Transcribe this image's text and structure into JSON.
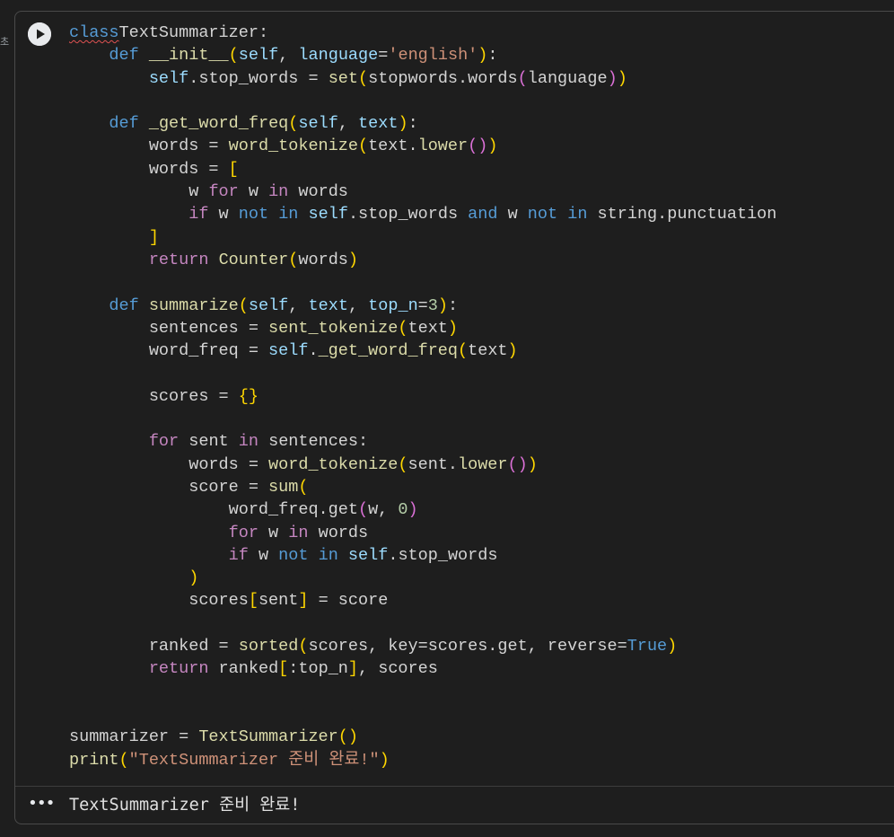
{
  "gutter": {
    "label": "초"
  },
  "cell": {
    "run_label": "run-cell",
    "code_lines": [
      [
        [
          "kw",
          "class",
          true
        ],
        [
          "",
          "TextSummarizer:"
        ]
      ],
      [
        [
          "",
          "    "
        ],
        [
          "kw",
          "def"
        ],
        [
          "",
          " "
        ],
        [
          "fn",
          "__init__"
        ],
        [
          "p1",
          "("
        ],
        [
          "prm",
          "self"
        ],
        [
          "",
          ", "
        ],
        [
          "prm",
          "language"
        ],
        [
          "",
          "="
        ],
        [
          "str",
          "'english'"
        ],
        [
          "p1",
          ")"
        ],
        [
          "",
          ":"
        ]
      ],
      [
        [
          "",
          "        "
        ],
        [
          "prm",
          "self"
        ],
        [
          "",
          ".stop_words = "
        ],
        [
          "fn",
          "set"
        ],
        [
          "p1",
          "("
        ],
        [
          "",
          "stopwords.words"
        ],
        [
          "p2",
          "("
        ],
        [
          "",
          "language"
        ],
        [
          "p2",
          ")"
        ],
        [
          "p1",
          ")"
        ]
      ],
      [
        [
          "",
          ""
        ]
      ],
      [
        [
          "",
          "    "
        ],
        [
          "kw",
          "def"
        ],
        [
          "",
          " "
        ],
        [
          "fn",
          "_get_word_freq"
        ],
        [
          "p1",
          "("
        ],
        [
          "prm",
          "self"
        ],
        [
          "",
          ", "
        ],
        [
          "prm",
          "text"
        ],
        [
          "p1",
          ")"
        ],
        [
          "",
          ":"
        ]
      ],
      [
        [
          "",
          "        words = "
        ],
        [
          "fn",
          "word_tokenize"
        ],
        [
          "p1",
          "("
        ],
        [
          "",
          "text."
        ],
        [
          "fn",
          "lower"
        ],
        [
          "p2",
          "()"
        ],
        [
          "p1",
          ")"
        ]
      ],
      [
        [
          "",
          "        words = "
        ],
        [
          "p1",
          "["
        ]
      ],
      [
        [
          "",
          "            w "
        ],
        [
          "ctl",
          "for"
        ],
        [
          "",
          " w "
        ],
        [
          "ctl",
          "in"
        ],
        [
          "",
          " words"
        ]
      ],
      [
        [
          "",
          "            "
        ],
        [
          "ctl",
          "if"
        ],
        [
          "",
          " w "
        ],
        [
          "kw",
          "not"
        ],
        [
          "",
          " "
        ],
        [
          "kw",
          "in"
        ],
        [
          "",
          " "
        ],
        [
          "prm",
          "self"
        ],
        [
          "",
          ".stop_words "
        ],
        [
          "kw",
          "and"
        ],
        [
          "",
          " w "
        ],
        [
          "kw",
          "not"
        ],
        [
          "",
          " "
        ],
        [
          "kw",
          "in"
        ],
        [
          "",
          " string.punctuation"
        ]
      ],
      [
        [
          "",
          "        "
        ],
        [
          "p1",
          "]"
        ]
      ],
      [
        [
          "",
          "        "
        ],
        [
          "ctl",
          "return"
        ],
        [
          "",
          " "
        ],
        [
          "fn",
          "Counter"
        ],
        [
          "p1",
          "("
        ],
        [
          "",
          "words"
        ],
        [
          "p1",
          ")"
        ]
      ],
      [
        [
          "",
          ""
        ]
      ],
      [
        [
          "",
          "    "
        ],
        [
          "kw",
          "def"
        ],
        [
          "",
          " "
        ],
        [
          "fn",
          "summarize"
        ],
        [
          "p1",
          "("
        ],
        [
          "prm",
          "self"
        ],
        [
          "",
          ", "
        ],
        [
          "prm",
          "text"
        ],
        [
          "",
          ", "
        ],
        [
          "prm",
          "top_n"
        ],
        [
          "",
          "="
        ],
        [
          "num",
          "3"
        ],
        [
          "p1",
          ")"
        ],
        [
          "",
          ":"
        ]
      ],
      [
        [
          "",
          "        sentences = "
        ],
        [
          "fn",
          "sent_tokenize"
        ],
        [
          "p1",
          "("
        ],
        [
          "",
          "text"
        ],
        [
          "p1",
          ")"
        ]
      ],
      [
        [
          "",
          "        word_freq = "
        ],
        [
          "prm",
          "self"
        ],
        [
          "",
          "."
        ],
        [
          "fn",
          "_get_word_freq"
        ],
        [
          "p1",
          "("
        ],
        [
          "",
          "text"
        ],
        [
          "p1",
          ")"
        ]
      ],
      [
        [
          "",
          ""
        ]
      ],
      [
        [
          "",
          "        scores = "
        ],
        [
          "p1",
          "{}"
        ]
      ],
      [
        [
          "",
          ""
        ]
      ],
      [
        [
          "",
          "        "
        ],
        [
          "ctl",
          "for"
        ],
        [
          "",
          " sent "
        ],
        [
          "ctl",
          "in"
        ],
        [
          "",
          " sentences:"
        ]
      ],
      [
        [
          "",
          "            words = "
        ],
        [
          "fn",
          "word_tokenize"
        ],
        [
          "p1",
          "("
        ],
        [
          "",
          "sent."
        ],
        [
          "fn",
          "lower"
        ],
        [
          "p2",
          "()"
        ],
        [
          "p1",
          ")"
        ]
      ],
      [
        [
          "",
          "            score = "
        ],
        [
          "fn",
          "sum"
        ],
        [
          "p1",
          "("
        ]
      ],
      [
        [
          "",
          "                word_freq.get"
        ],
        [
          "p2",
          "("
        ],
        [
          "",
          "w, "
        ],
        [
          "num",
          "0"
        ],
        [
          "p2",
          ")"
        ]
      ],
      [
        [
          "",
          "                "
        ],
        [
          "ctl",
          "for"
        ],
        [
          "",
          " w "
        ],
        [
          "ctl",
          "in"
        ],
        [
          "",
          " words"
        ]
      ],
      [
        [
          "",
          "                "
        ],
        [
          "ctl",
          "if"
        ],
        [
          "",
          " w "
        ],
        [
          "kw",
          "not"
        ],
        [
          "",
          " "
        ],
        [
          "kw",
          "in"
        ],
        [
          "",
          " "
        ],
        [
          "prm",
          "self"
        ],
        [
          "",
          ".stop_words"
        ]
      ],
      [
        [
          "",
          "            "
        ],
        [
          "p1",
          ")"
        ]
      ],
      [
        [
          "",
          "            scores"
        ],
        [
          "p1",
          "["
        ],
        [
          "",
          "sent"
        ],
        [
          "p1",
          "]"
        ],
        [
          "",
          " = score"
        ]
      ],
      [
        [
          "",
          ""
        ]
      ],
      [
        [
          "",
          "        ranked = "
        ],
        [
          "fn",
          "sorted"
        ],
        [
          "p1",
          "("
        ],
        [
          "",
          "scores, key=scores.get, reverse="
        ],
        [
          "bool",
          "True"
        ],
        [
          "p1",
          ")"
        ]
      ],
      [
        [
          "",
          "        "
        ],
        [
          "ctl",
          "return"
        ],
        [
          "",
          " ranked"
        ],
        [
          "p1",
          "["
        ],
        [
          "",
          ":top_n"
        ],
        [
          "p1",
          "]"
        ],
        [
          "",
          ", scores"
        ]
      ],
      [
        [
          "",
          ""
        ]
      ],
      [
        [
          "",
          ""
        ]
      ],
      [
        [
          "",
          "summarizer = "
        ],
        [
          "fn",
          "TextSummarizer"
        ],
        [
          "p1",
          "()"
        ]
      ],
      [
        [
          "fn",
          "print"
        ],
        [
          "p1",
          "("
        ],
        [
          "str",
          "\"TextSummarizer 준비 완료!\""
        ],
        [
          "p1",
          ")"
        ]
      ]
    ]
  },
  "output": {
    "menu_label": "•••",
    "text": "TextSummarizer 준비 완료!"
  }
}
